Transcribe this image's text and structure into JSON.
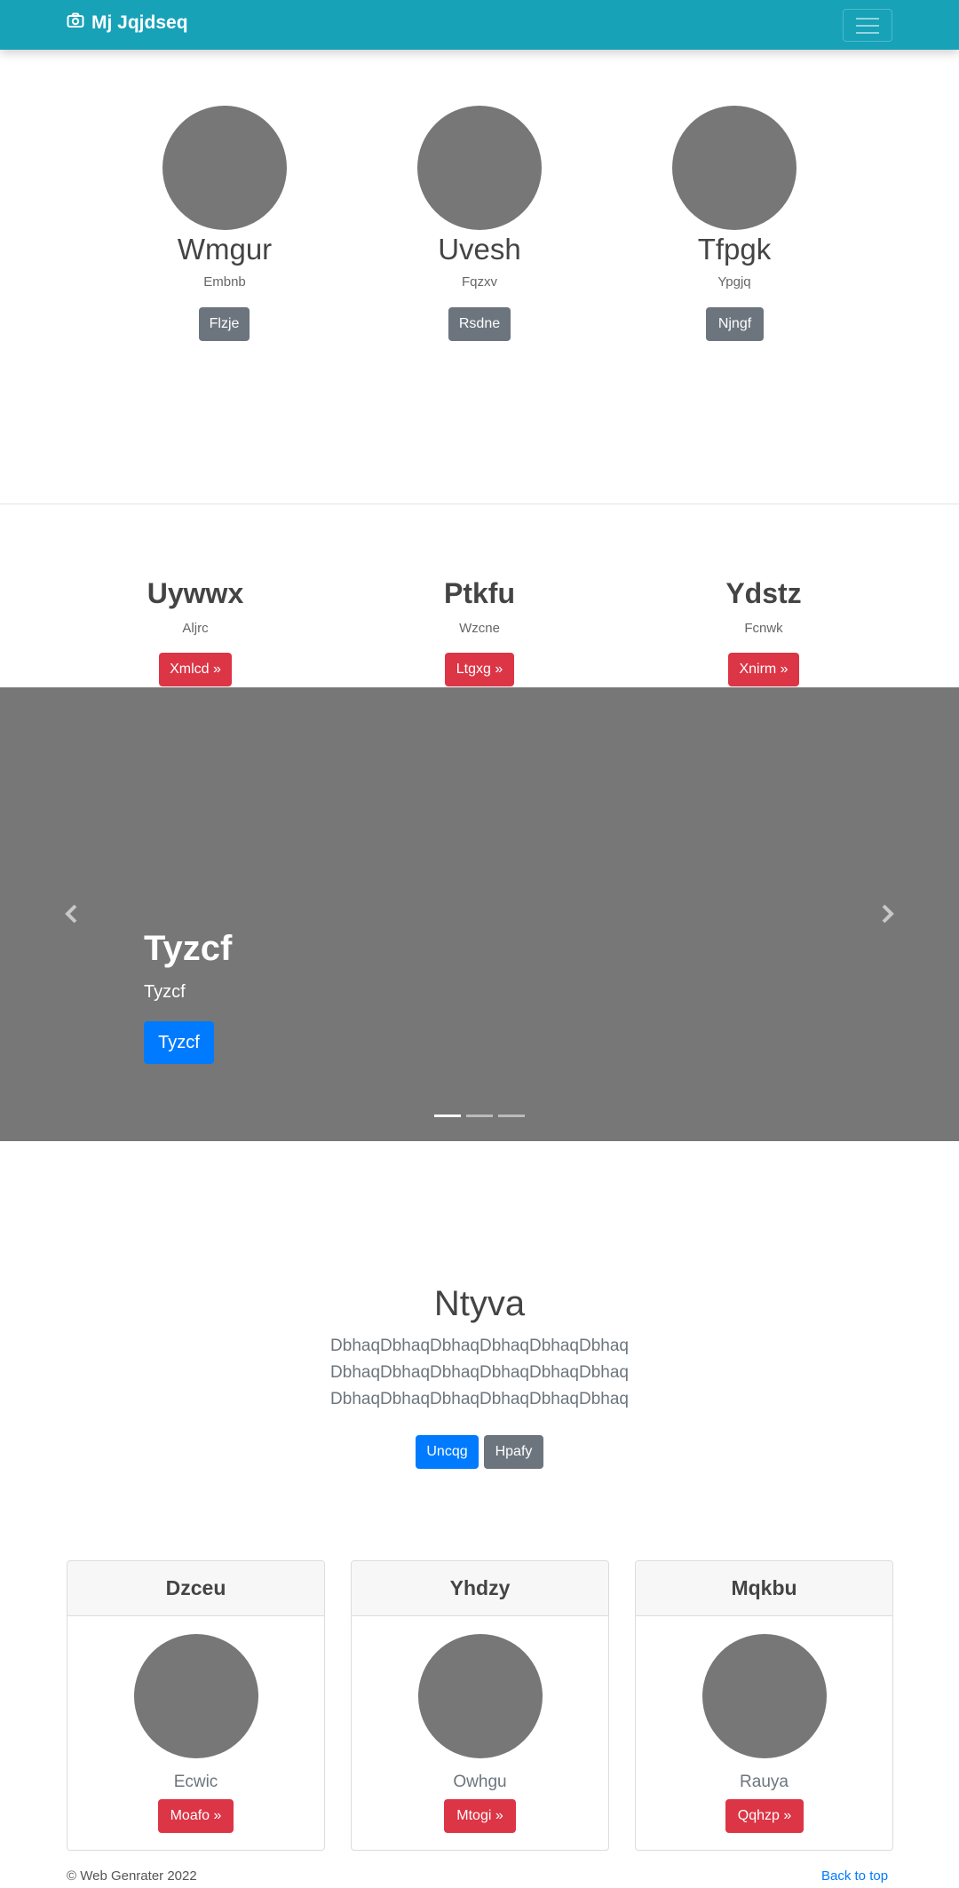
{
  "navbar": {
    "brand": "Mj Jqjdseq",
    "brand_icon": "camera-icon",
    "toggler_icon": "hamburger-menu-icon"
  },
  "profiles": [
    {
      "name": "Wmgur",
      "sub": "Embnb",
      "button": "Flzje"
    },
    {
      "name": "Uvesh",
      "sub": "Fqzxv",
      "button": "Rsdne"
    },
    {
      "name": "Tfpgk",
      "sub": "Ypgjq",
      "button": "Njngf"
    }
  ],
  "features": [
    {
      "title": "Uywwx",
      "sub": "Aljrc",
      "button": "Xmlcd »"
    },
    {
      "title": "Ptkfu",
      "sub": "Wzcne",
      "button": "Ltgxg »"
    },
    {
      "title": "Ydstz",
      "sub": "Fcnwk",
      "button": "Xnirm »"
    }
  ],
  "carousel": {
    "title": "Tyzcf",
    "text": "Tyzcf",
    "button": "Tyzcf",
    "prev_icon": "chevron-left-icon",
    "next_icon": "chevron-right-icon",
    "slide_count": 3,
    "active_slide": 1
  },
  "jumbo": {
    "title": "Ntyva",
    "lines": [
      "DbhaqDbhaqDbhaqDbhaqDbhaqDbhaq",
      "DbhaqDbhaqDbhaqDbhaqDbhaqDbhaq",
      "DbhaqDbhaqDbhaqDbhaqDbhaqDbhaq"
    ],
    "primary_button": "Uncqg",
    "secondary_button": "Hpafy"
  },
  "cards": [
    {
      "header": "Dzceu",
      "text": "Ecwic",
      "button": "Moafo »"
    },
    {
      "header": "Yhdzy",
      "text": "Owhgu",
      "button": "Mtogi »"
    },
    {
      "header": "Mqkbu",
      "text": "Rauya",
      "button": "Qqhzp »"
    }
  ],
  "footer": {
    "copyright": "© Web Genrater 2022",
    "back_to_top": "Back to top"
  },
  "colors": {
    "navbar": "#17a2b8",
    "primary": "#007bff",
    "danger": "#dc3545",
    "secondary": "#6c757d",
    "placeholder": "#777777"
  }
}
